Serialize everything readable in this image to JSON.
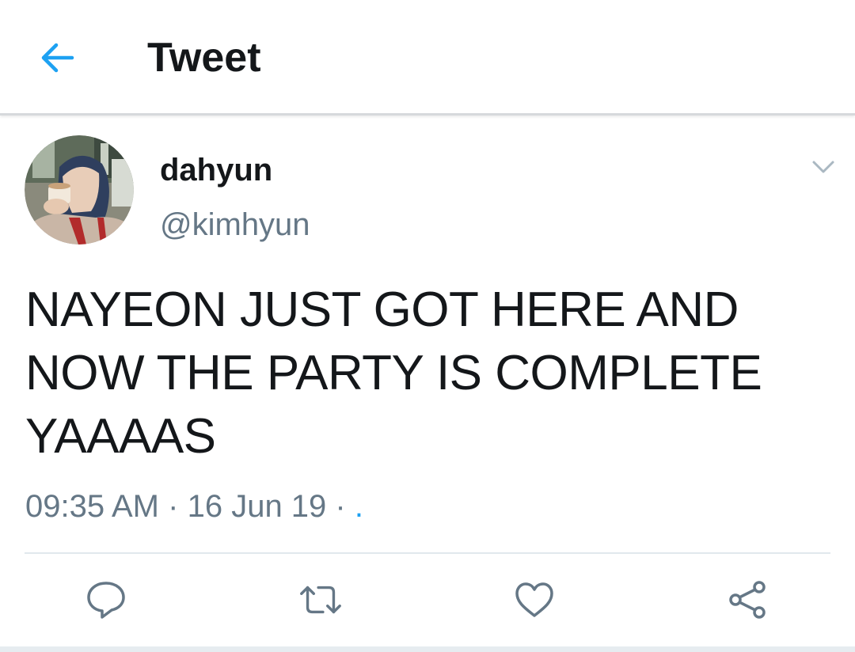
{
  "header": {
    "title": "Tweet",
    "back_icon": "arrow-left-icon"
  },
  "tweet": {
    "author": {
      "display_name": "dahyun",
      "handle": "@kimhyun"
    },
    "text_lines": [
      "NAYEON JUST GOT HERE AND",
      "NOW THE PARTY IS COMPLETE",
      "YAAAAS"
    ],
    "time": "09:35 AM",
    "date": "16 Jun 19",
    "separator": "·",
    "source": "."
  },
  "actions": {
    "reply_icon": "reply-icon",
    "retweet_icon": "retweet-icon",
    "like_icon": "heart-icon",
    "share_icon": "share-icon"
  },
  "colors": {
    "accent": "#1da1f2",
    "primary_text": "#14171a",
    "secondary_text": "#657786",
    "icon_gray": "#657786"
  }
}
